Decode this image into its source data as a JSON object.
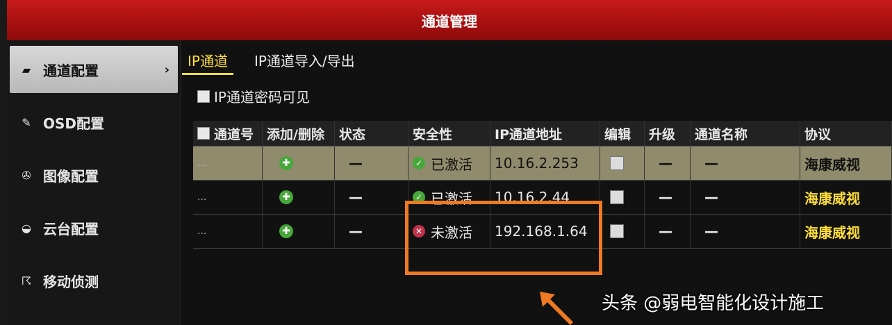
{
  "window": {
    "title": "通道管理"
  },
  "sidebar": {
    "items": [
      {
        "label": "通道配置",
        "chevron": "›"
      },
      {
        "label": "OSD配置"
      },
      {
        "label": "图像配置"
      },
      {
        "label": "云台配置"
      },
      {
        "label": "移动侦测"
      }
    ]
  },
  "tabs": [
    {
      "label": "IP通道"
    },
    {
      "label": "IP通道导入/导出"
    }
  ],
  "password_visible": {
    "label": "IP通道密码可见"
  },
  "table": {
    "columns": [
      "通道号",
      "添加/删除",
      "状态",
      "安全性",
      "IP通道地址",
      "编辑",
      "升级",
      "通道名称",
      "协议"
    ],
    "rows": [
      {
        "no": "...",
        "status": "—",
        "security": "已激活",
        "ip": "10.16.2.253",
        "upgrade": "—",
        "name": "—",
        "protocol": "海康威视"
      },
      {
        "no": "...",
        "status": "—",
        "security": "已激活",
        "ip": "10.16.2.44",
        "upgrade": "—",
        "name": "—",
        "protocol": "海康威视"
      },
      {
        "no": "...",
        "status": "—",
        "security": "未激活",
        "ip": "192.168.1.64",
        "upgrade": "—",
        "name": "—",
        "protocol": "海康威视"
      }
    ]
  },
  "watermark": "头条 @弱电智能化设计施工",
  "colors": {
    "accent": "#ffde3b",
    "highlight": "#ee7a22",
    "titlebar": "#b01212"
  }
}
